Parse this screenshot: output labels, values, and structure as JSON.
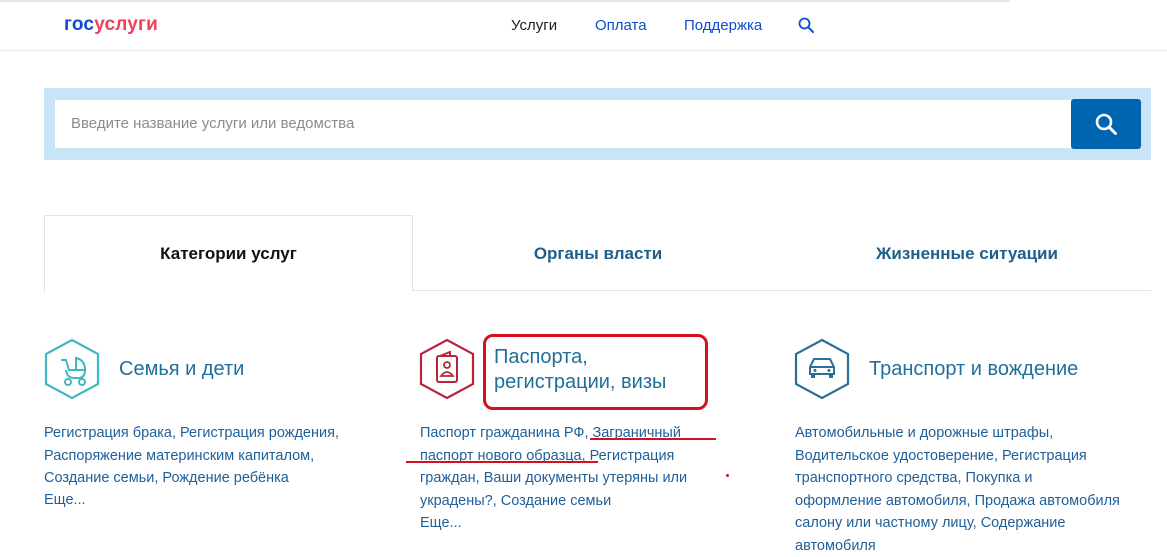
{
  "header": {
    "logo_part1": "гос",
    "logo_part2": "услуги",
    "nav": [
      "Услуги",
      "Оплата",
      "Поддержка"
    ]
  },
  "search": {
    "placeholder": "Введите название услуги или ведомства"
  },
  "tabs": [
    "Категории услуг",
    "Органы власти",
    "Жизненные ситуации"
  ],
  "categories": [
    {
      "title": "Семья и дети",
      "text": "Регистрация брака, Регистрация рождения, Распоряжение материнским капиталом, Создание семьи, Рождение ребёнка",
      "more": "Еще..."
    },
    {
      "title_line1": "Паспорта,",
      "title_line2": "регистрации, визы",
      "text": "Паспорт гражданина РФ, Заграничный паспорт нового образца, Регистрация граждан, Ваши документы утеряны или украдены?, Создание семьи",
      "more": "Еще..."
    },
    {
      "title": "Транспорт и вождение",
      "text": "Автомобильные и дорожные штрафы, Водительское удостоверение, Регистрация транспортного средства, Покупка и оформление автомобиля, Продажа автомобиля салону или частному лицу, Содержание автомобиля"
    }
  ],
  "colors": {
    "brand_blue": "#0d4cd3",
    "brand_red": "#ee3f58",
    "search_button": "#0065b1",
    "search_band": "#c9e4f6",
    "family_icon": "#3fb8c4",
    "passport_icon": "#b5263c",
    "transport_icon": "#2a6f98",
    "annotation_red": "#d4111e"
  },
  "icons": [
    "search-icon",
    "stroller-icon",
    "passport-icon",
    "car-icon"
  ]
}
